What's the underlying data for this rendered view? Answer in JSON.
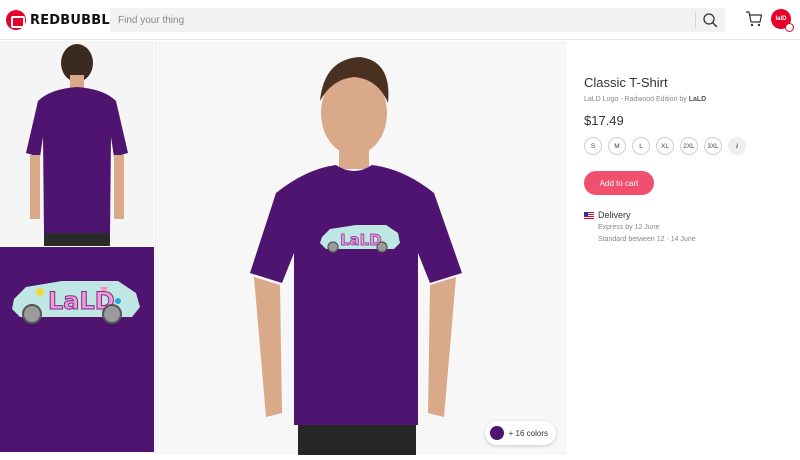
{
  "header": {
    "brand": "REDBUBBLE",
    "search_placeholder": "Find your thing",
    "avatar_text": "lalD"
  },
  "gallery": {
    "colors_label": "+ 16 colors",
    "selected_color": "#4f1470"
  },
  "product": {
    "title": "Classic T-Shirt",
    "subtitle_prefix": "LaLD Logo - Radwood Edition by ",
    "artist": "LaLD",
    "price": "$17.49",
    "sizes": [
      "S",
      "M",
      "L",
      "XL",
      "2XL",
      "3XL"
    ],
    "size_info": "i",
    "add_to_cart": "Add to cart",
    "delivery_title": "Delivery",
    "express": "Express by 12 June",
    "standard": "Standard between 12 - 14 June"
  },
  "colors": {
    "accent": "#f0506e",
    "brand": "#e4002b",
    "shirt": "#4f1470"
  }
}
